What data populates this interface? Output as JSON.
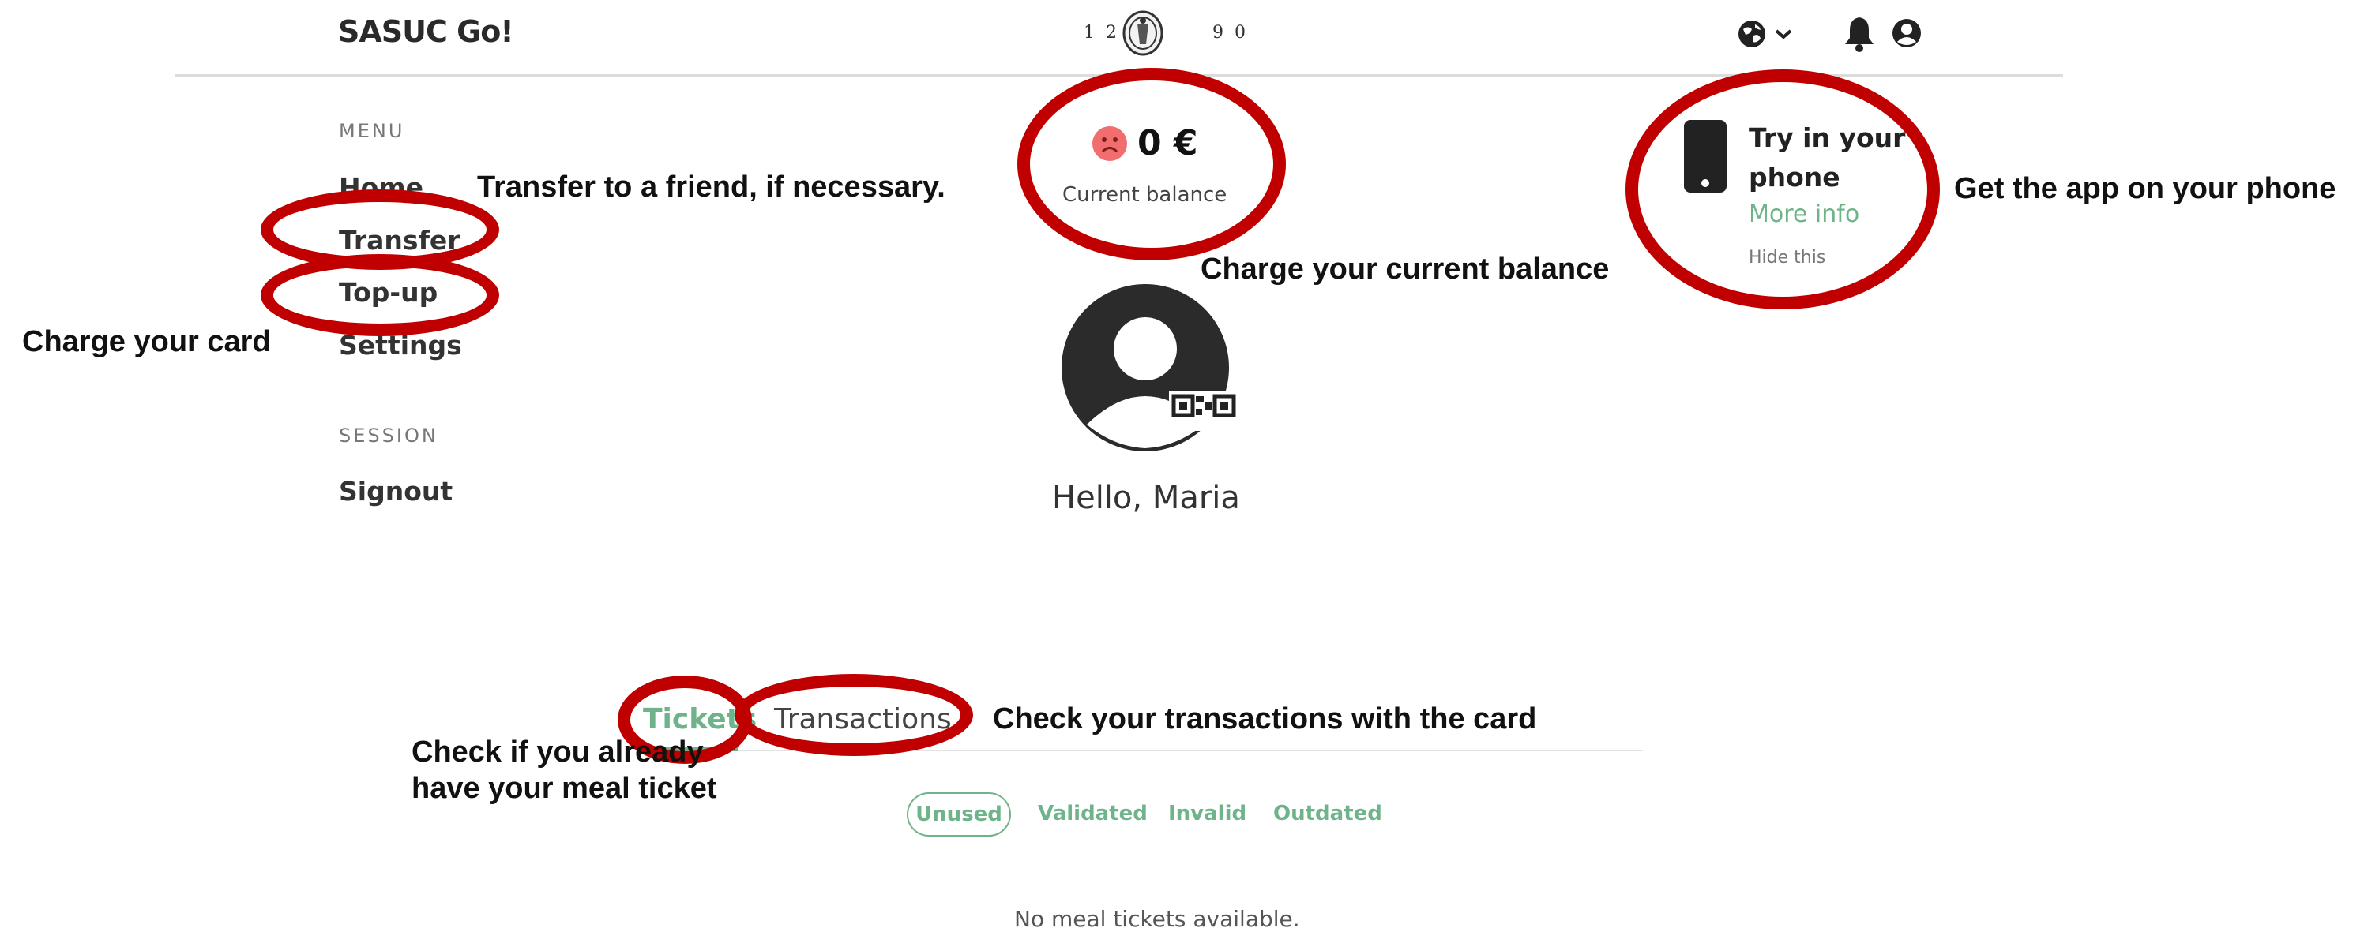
{
  "header": {
    "brand": "SASUC Go!",
    "year_left": "12",
    "year_right": "90",
    "icons": [
      "seal-logo",
      "globe-icon",
      "chevron-down-icon",
      "bell-icon",
      "user-circle-icon"
    ]
  },
  "sidebar": {
    "menu_heading": "MENU",
    "items": [
      {
        "label": "Home"
      },
      {
        "label": "Transfer"
      },
      {
        "label": "Top-up"
      },
      {
        "label": "Settings"
      }
    ],
    "session_heading": "SESSION",
    "signout": "Signout"
  },
  "balance": {
    "value": "0 €",
    "label": "Current balance",
    "icon": "sad-face-icon",
    "icon_color": "#f26d6d"
  },
  "profile": {
    "greeting": "Hello, Maria",
    "icons": [
      "avatar-icon",
      "qr-code-icon"
    ]
  },
  "promo": {
    "title": "Try in your phone",
    "more_info": "More info",
    "hide": "Hide this",
    "icon": "smartphone-icon"
  },
  "tabs": {
    "items": [
      {
        "label": "Tickets",
        "active": true
      },
      {
        "label": "Transactions",
        "active": false
      }
    ]
  },
  "filters": {
    "items": [
      {
        "label": "Unused",
        "selected": true
      },
      {
        "label": "Validated",
        "selected": false
      },
      {
        "label": "Invalid",
        "selected": false
      },
      {
        "label": "Outdated",
        "selected": false
      }
    ]
  },
  "empty_message": "No meal tickets available.",
  "annotations": {
    "transfer": "Transfer to a friend, if necessary.",
    "charge_card": "Charge your card",
    "charge_balance": "Charge your current balance",
    "get_app": "Get the app on your phone",
    "transactions": "Check your transactions with the card",
    "tickets": "Check if you already have your meal ticket"
  },
  "colors": {
    "accent": "#6fb38a",
    "annotation_ring": "#c00000",
    "text_dark": "#333333"
  }
}
